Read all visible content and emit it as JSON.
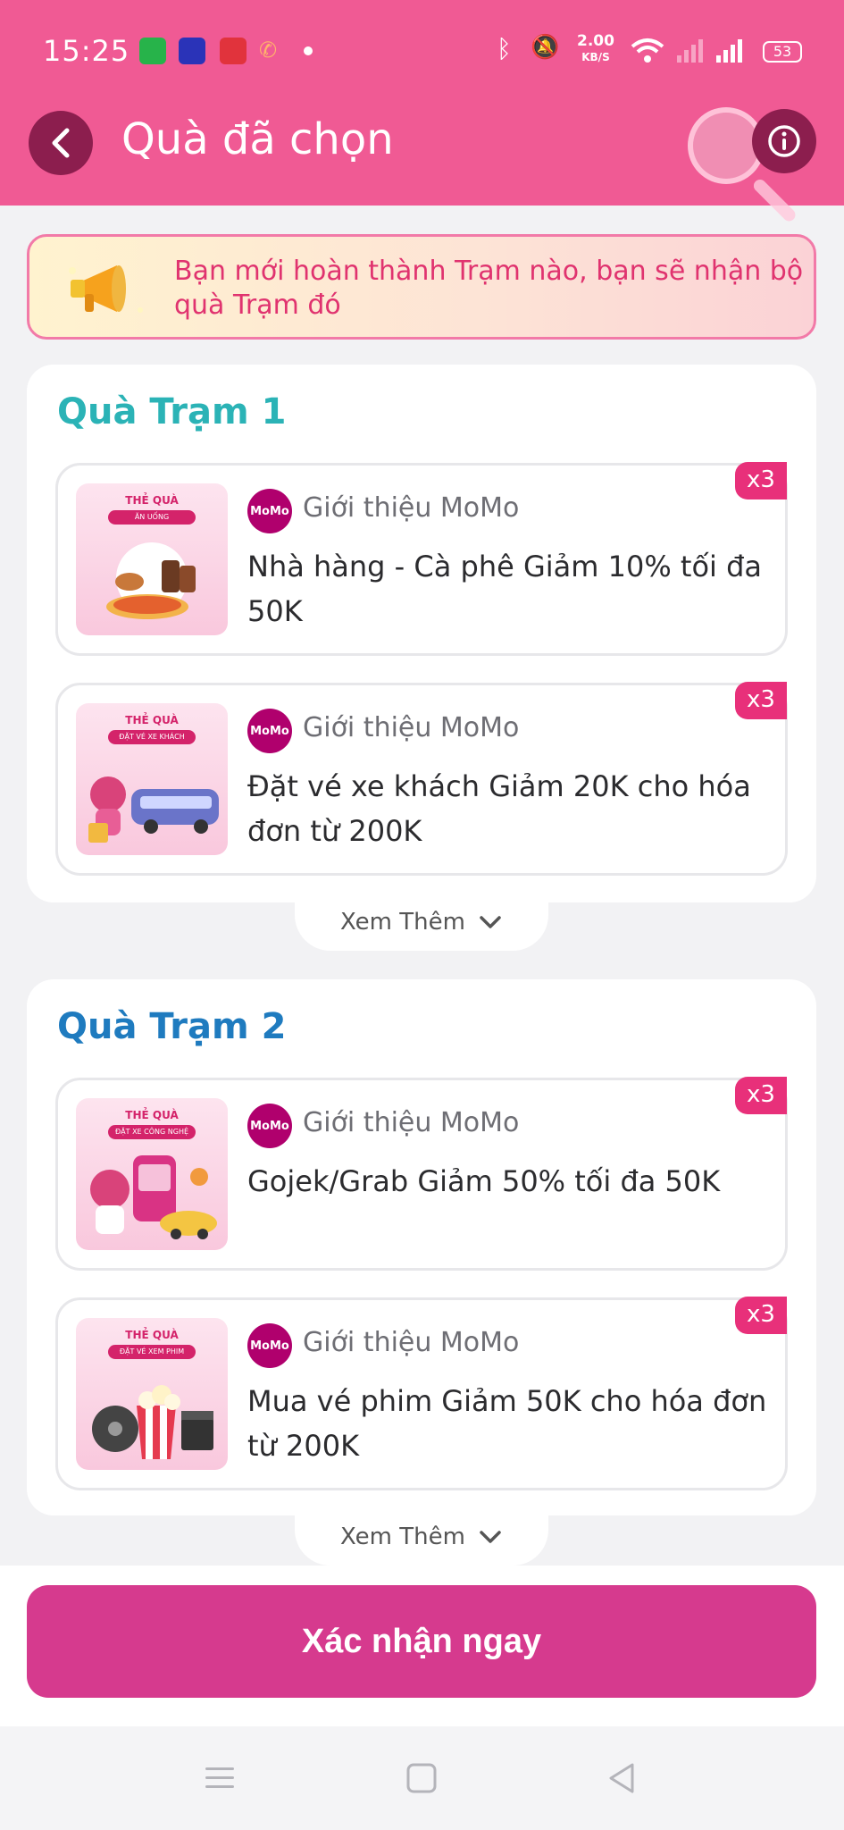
{
  "status_bar": {
    "time": "15:25",
    "speed_value": "2.00",
    "speed_unit": "KB/S",
    "battery": "53"
  },
  "header": {
    "title": "Quà đã chọn"
  },
  "notice": {
    "text": "Bạn mới hoàn thành Trạm nào, bạn sẽ nhận bộ quà Trạm đó"
  },
  "stations": [
    {
      "title": "Quà Trạm 1",
      "title_color": "#2bb3b6",
      "gifts": [
        {
          "thumb_label": "THẺ QUÀ",
          "thumb_tag": "ĂN UỐNG",
          "brand": "Giới thiệu MoMo",
          "desc": "Nhà hàng - Cà phê Giảm 10% tối đa 50K",
          "qty": "x3"
        },
        {
          "thumb_label": "THẺ QUÀ",
          "thumb_tag": "ĐẶT VÉ XE KHÁCH",
          "brand": "Giới thiệu MoMo",
          "desc": "Đặt vé xe khách Giảm 20K cho hóa đơn từ 200K",
          "qty": "x3"
        }
      ],
      "more_label": "Xem Thêm"
    },
    {
      "title": "Quà Trạm 2",
      "title_color": "#1f7bbf",
      "gifts": [
        {
          "thumb_label": "THẺ QUÀ",
          "thumb_tag": "ĐẶT XE CÔNG NGHỆ",
          "brand": "Giới thiệu MoMo",
          "desc": "Gojek/Grab Giảm 50% tối đa 50K",
          "qty": "x3"
        },
        {
          "thumb_label": "THẺ QUÀ",
          "thumb_tag": "ĐẶT VÉ XEM PHIM",
          "brand": "Giới thiệu MoMo",
          "desc": "Mua vé phim Giảm 50K cho hóa đơn từ 200K",
          "qty": "x3"
        }
      ],
      "more_label": "Xem Thêm"
    }
  ],
  "brand_logo_text": "MoMo",
  "confirm_button": "Xác nhận ngay",
  "colors": {
    "header": "#f05a94",
    "accent": "#d63a8e",
    "badge": "#e8307a"
  },
  "icons": {
    "back": "chevron-left-icon",
    "info": "info-icon",
    "more": "chevron-down-icon",
    "nav_menu": "menu-icon",
    "nav_home": "square-home-icon",
    "nav_back": "triangle-back-icon"
  }
}
